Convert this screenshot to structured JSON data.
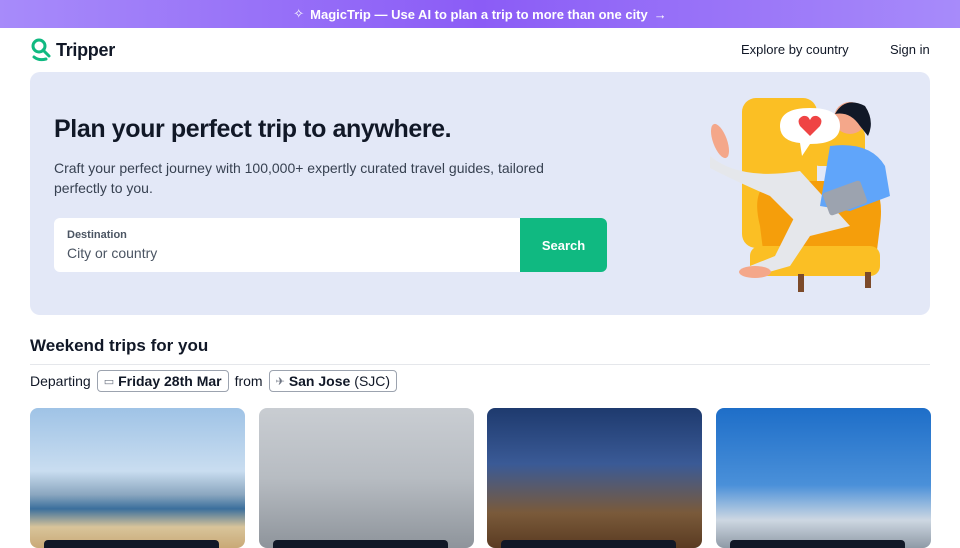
{
  "banner": {
    "spark": "✧",
    "text": "MagicTrip — Use AI to plan a trip to more than one city",
    "arrow": "→",
    "color_start": "#a78bfa",
    "color_end": "#8b5cf6"
  },
  "nav": {
    "logo": "Tripper",
    "explore": "Explore by country",
    "signin": "Sign in",
    "brand_color": "#10b981"
  },
  "hero": {
    "title": "Plan your perfect trip to anywhere.",
    "subtitle": "Craft your perfect journey with 100,000+ expertly curated travel guides, tailored perfectly to you.",
    "search": {
      "label": "Destination",
      "placeholder": "City or country",
      "button": "Search"
    },
    "background": "#e3e8f7"
  },
  "weekend": {
    "title": "Weekend trips for you",
    "departing_label": "Departing",
    "date": "Friday 28th Mar",
    "from_label": "from",
    "origin_city": "San Jose",
    "origin_code": "(SJC)"
  },
  "cards": [
    {
      "name": "beach",
      "icon": "photo"
    },
    {
      "name": "skyline-fog",
      "icon": "photo"
    },
    {
      "name": "las-vegas",
      "icon": "photo"
    },
    {
      "name": "city-blue-sky",
      "icon": "photo"
    }
  ]
}
